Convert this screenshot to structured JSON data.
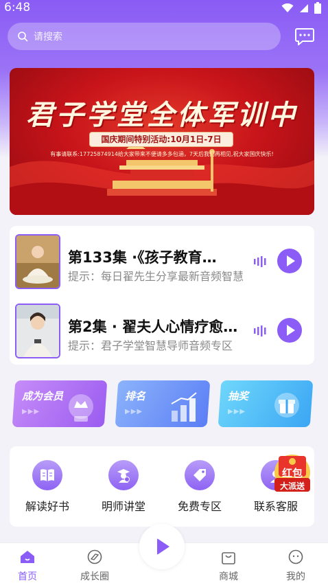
{
  "status_bar": {
    "time": "6:48"
  },
  "search": {
    "placeholder": "请搜索"
  },
  "banner": {
    "title": "君子学堂全体军训中",
    "pill": "国庆期间特别活动:10月1日-7日",
    "notice": "有事请联系:17725874914给大家带来不便请多多包涵，7天后我们再相见,祝大家国庆快乐!"
  },
  "audio_list": [
    {
      "title": "第133集 ·《孩子教育…",
      "desc": "提示：每日翟先生分享最新音频智慧"
    },
    {
      "title": "第2集 · 翟夫人心情疗愈…",
      "desc": "提示：君子学堂智慧导师音频专区"
    }
  ],
  "features": [
    {
      "label": "成为会员",
      "color_from": "#c58cf8",
      "color_to": "#9b5cf0",
      "icon": "crown-icon"
    },
    {
      "label": "排名",
      "color_from": "#8bb3fb",
      "color_to": "#5b7ef5",
      "icon": "chart-icon"
    },
    {
      "label": "抽奖",
      "color_from": "#6fd7fb",
      "color_to": "#3ba6f4",
      "icon": "gift-icon"
    }
  ],
  "quick_links": [
    {
      "label": "解读好书",
      "icon": "book-icon"
    },
    {
      "label": "明师讲堂",
      "icon": "teacher-icon"
    },
    {
      "label": "免费专区",
      "icon": "tag-icon"
    },
    {
      "label": "联系客服",
      "icon": "service-icon"
    }
  ],
  "redpack": {
    "line1": "红包",
    "line2": "大派送"
  },
  "tabbar": [
    {
      "label": "首页",
      "icon": "home-icon",
      "active": true
    },
    {
      "label": "成长圈",
      "icon": "circle-icon",
      "active": false
    },
    {
      "label": "商城",
      "icon": "bag-icon",
      "active": false
    },
    {
      "label": "我的",
      "icon": "profile-icon",
      "active": false
    }
  ],
  "colors": {
    "accent": "#8b5cf6",
    "banner_red": "#c8141a"
  }
}
